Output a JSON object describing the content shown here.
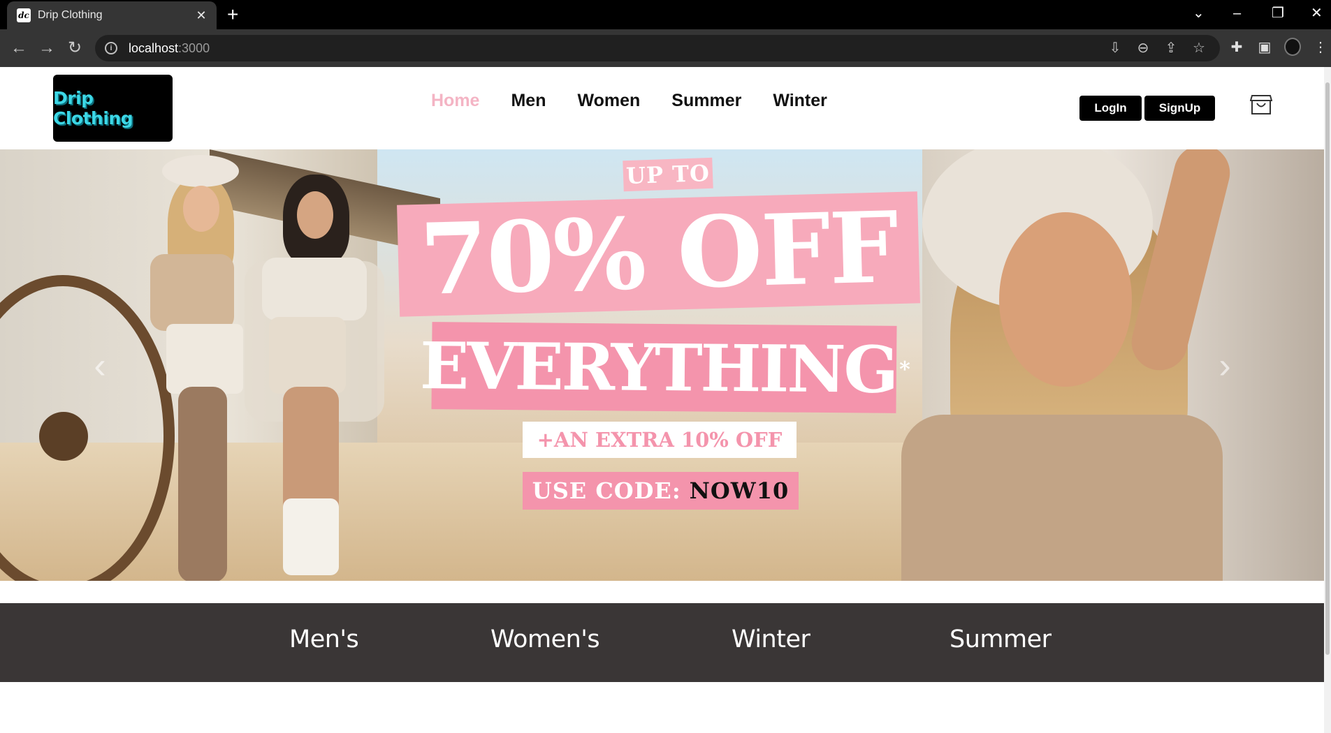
{
  "browser": {
    "tab_title": "Drip Clothing",
    "favicon_text": "dc",
    "tab_close_glyph": "✕",
    "new_tab_glyph": "+",
    "url_host": "localhost",
    "url_port": ":3000",
    "icons": [
      "back-icon",
      "forward-icon",
      "reload-icon",
      "info-icon",
      "install-icon",
      "zoom-icon",
      "share-icon",
      "bookmark-star-icon",
      "extensions-icon",
      "side-panel-icon",
      "profile-avatar",
      "menu-icon"
    ]
  },
  "site": {
    "logo_text": "Drip Clothing",
    "logo_color": "#3cd7e6",
    "nav": [
      {
        "label": "Home",
        "active": true
      },
      {
        "label": "Men",
        "active": false
      },
      {
        "label": "Women",
        "active": false
      },
      {
        "label": "Summer",
        "active": false
      },
      {
        "label": "Winter",
        "active": false
      }
    ],
    "login_label": "LogIn",
    "signup_label": "SignUp",
    "active_color": "#f4b4c4"
  },
  "hero": {
    "upto": "UP TO",
    "headline": "70% OFF",
    "subheadline": "EVERYTHING",
    "asterisk": "*",
    "extra": "+AN EXTRA 10% OFF",
    "code_prefix": "USE CODE:",
    "code": "NOW10",
    "prev_glyph": "‹",
    "next_glyph": "›",
    "accent": "#f494ac"
  },
  "categories": [
    "Men's",
    "Women's",
    "Winter",
    "Summer"
  ]
}
